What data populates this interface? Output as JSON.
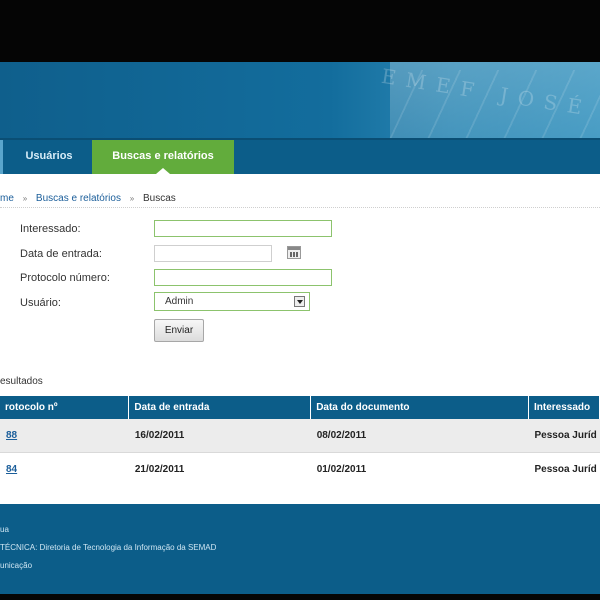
{
  "nav": {
    "tabs": [
      {
        "label": "Usuários",
        "active": false
      },
      {
        "label": "Buscas e relatórios",
        "active": true
      }
    ]
  },
  "breadcrumb": {
    "items": [
      "me",
      "Buscas e relatórios",
      "Buscas"
    ],
    "separator": "»"
  },
  "form": {
    "interessado": {
      "label": "Interessado:",
      "value": ""
    },
    "data_entrada": {
      "label": "Data de entrada:",
      "value": ""
    },
    "protocolo": {
      "label": "Protocolo número:",
      "value": ""
    },
    "usuario": {
      "label": "Usuário:",
      "selected": "Admin"
    },
    "submit_label": "Enviar"
  },
  "results": {
    "title": "esultados",
    "columns": [
      "rotocolo nº",
      "Data de entrada",
      "Data do documento",
      "Interessado"
    ],
    "rows": [
      {
        "protocolo": "88",
        "data_entrada": "16/02/2011",
        "data_documento": "08/02/2011",
        "interessado": "Pessoa Juríd"
      },
      {
        "protocolo": "84",
        "data_entrada": "21/02/2011",
        "data_documento": "01/02/2011",
        "interessado": "Pessoa Juríd"
      }
    ]
  },
  "footer": {
    "line1": "ua",
    "line2": "TÉCNICA: Diretoria de Tecnologia da Informação da SEMAD",
    "line3": "unicação"
  },
  "colors": {
    "primary": "#0c5d89",
    "accent": "#62ac3c",
    "link": "#1b5e9a"
  }
}
